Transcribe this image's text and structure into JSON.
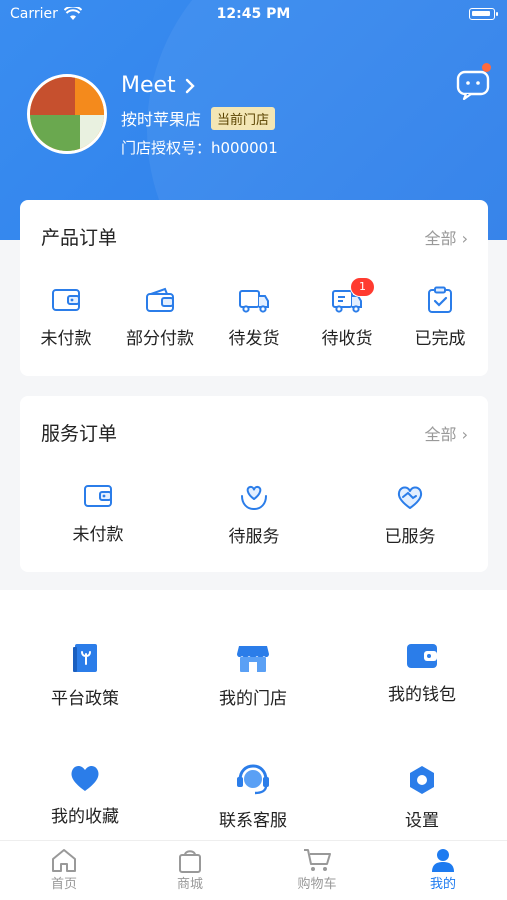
{
  "status_bar": {
    "carrier": "Carrier",
    "time": "12:45 PM"
  },
  "profile": {
    "name": "Meet",
    "store": "按时苹果店",
    "store_badge": "当前门店",
    "license_label": "门店授权号：h000001"
  },
  "product_orders": {
    "title": "产品订单",
    "all_label": "全部 ›",
    "items": [
      {
        "label": "未付款",
        "icon": "wallet-icon"
      },
      {
        "label": "部分付款",
        "icon": "wallet-partial-icon"
      },
      {
        "label": "待发货",
        "icon": "truck-icon"
      },
      {
        "label": "待收货",
        "icon": "delivery-truck-icon",
        "badge": "1"
      },
      {
        "label": "已完成",
        "icon": "clipboard-check-icon"
      }
    ]
  },
  "service_orders": {
    "title": "服务订单",
    "all_label": "全部 ›",
    "items": [
      {
        "label": "未付款",
        "icon": "wallet-icon"
      },
      {
        "label": "待服务",
        "icon": "hand-heart-icon"
      },
      {
        "label": "已服务",
        "icon": "handshake-heart-icon"
      }
    ]
  },
  "menu": [
    {
      "label": "平台政策",
      "icon": "policy-book-icon"
    },
    {
      "label": "我的门店",
      "icon": "store-icon"
    },
    {
      "label": "我的钱包",
      "icon": "wallet-icon"
    },
    {
      "label": "我的收藏",
      "icon": "heart-icon"
    },
    {
      "label": "联系客服",
      "icon": "headset-icon"
    },
    {
      "label": "设置",
      "icon": "settings-icon"
    }
  ],
  "tabbar": [
    {
      "label": "首页",
      "icon": "home-icon"
    },
    {
      "label": "商城",
      "icon": "bag-icon"
    },
    {
      "label": "购物车",
      "icon": "cart-icon"
    },
    {
      "label": "我的",
      "icon": "user-icon",
      "active": true
    }
  ],
  "colors": {
    "primary": "#2b7de9",
    "badge": "#ff3b30",
    "accent_dot": "#ff6a3d"
  }
}
